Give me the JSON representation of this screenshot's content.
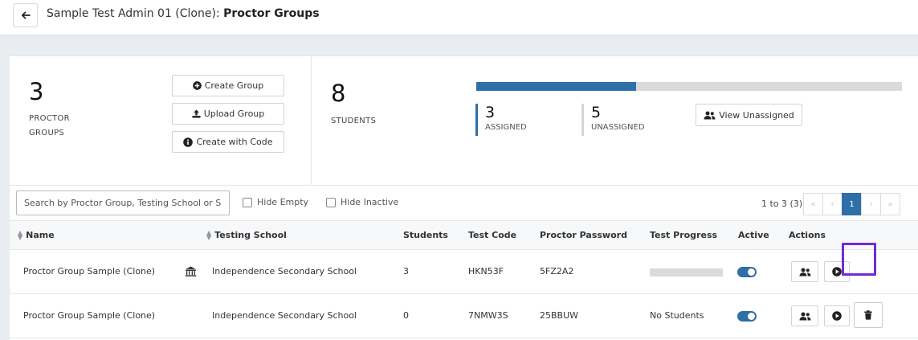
{
  "header": {
    "title_prefix": "Sample Test Admin 01 (Clone): ",
    "title_bold": "Proctor Groups"
  },
  "summary": {
    "proctor_groups_count": "3",
    "proctor_groups_label_line1": "PROCTOR",
    "proctor_groups_label_line2": "GROUPS",
    "buttons": {
      "create_group": "Create Group",
      "upload_group": "Upload Group",
      "create_with_code": "Create with Code"
    },
    "students_count": "8",
    "students_label": "STUDENTS",
    "assigned_count": "3",
    "assigned_label": "ASSIGNED",
    "unassigned_count": "5",
    "unassigned_label": "UNASSIGNED",
    "assigned_fraction": 0.375,
    "view_unassigned": "View Unassigned",
    "colors": {
      "accent": "#2e6fa7",
      "unassigned": "#dadada"
    }
  },
  "toolbar": {
    "search_placeholder": "Search by Proctor Group, Testing School or S",
    "hide_empty": "Hide Empty",
    "hide_inactive": "Hide Inactive",
    "range": "1 to 3 (3)",
    "pagination": {
      "first": "«",
      "prev": "‹",
      "current": "1",
      "next": "›",
      "last": "»"
    }
  },
  "table": {
    "columns": {
      "name": "Name",
      "school": "Testing School",
      "students": "Students",
      "test_code": "Test Code",
      "password": "Proctor Password",
      "progress": "Test Progress",
      "active": "Active",
      "actions": "Actions"
    },
    "rows": [
      {
        "name": "Proctor Group Sample (Clone)",
        "school": "Independence Secondary School",
        "students": "3",
        "test_code": "HKN53F",
        "password": "5FZ2A2",
        "progress": "",
        "active": true
      },
      {
        "name": "Proctor Group Sample (Clone)",
        "school": "Independence Secondary School",
        "students": "0",
        "test_code": "7NMW3S",
        "password": "25BBUW",
        "progress": "No Students",
        "active": true
      }
    ]
  }
}
